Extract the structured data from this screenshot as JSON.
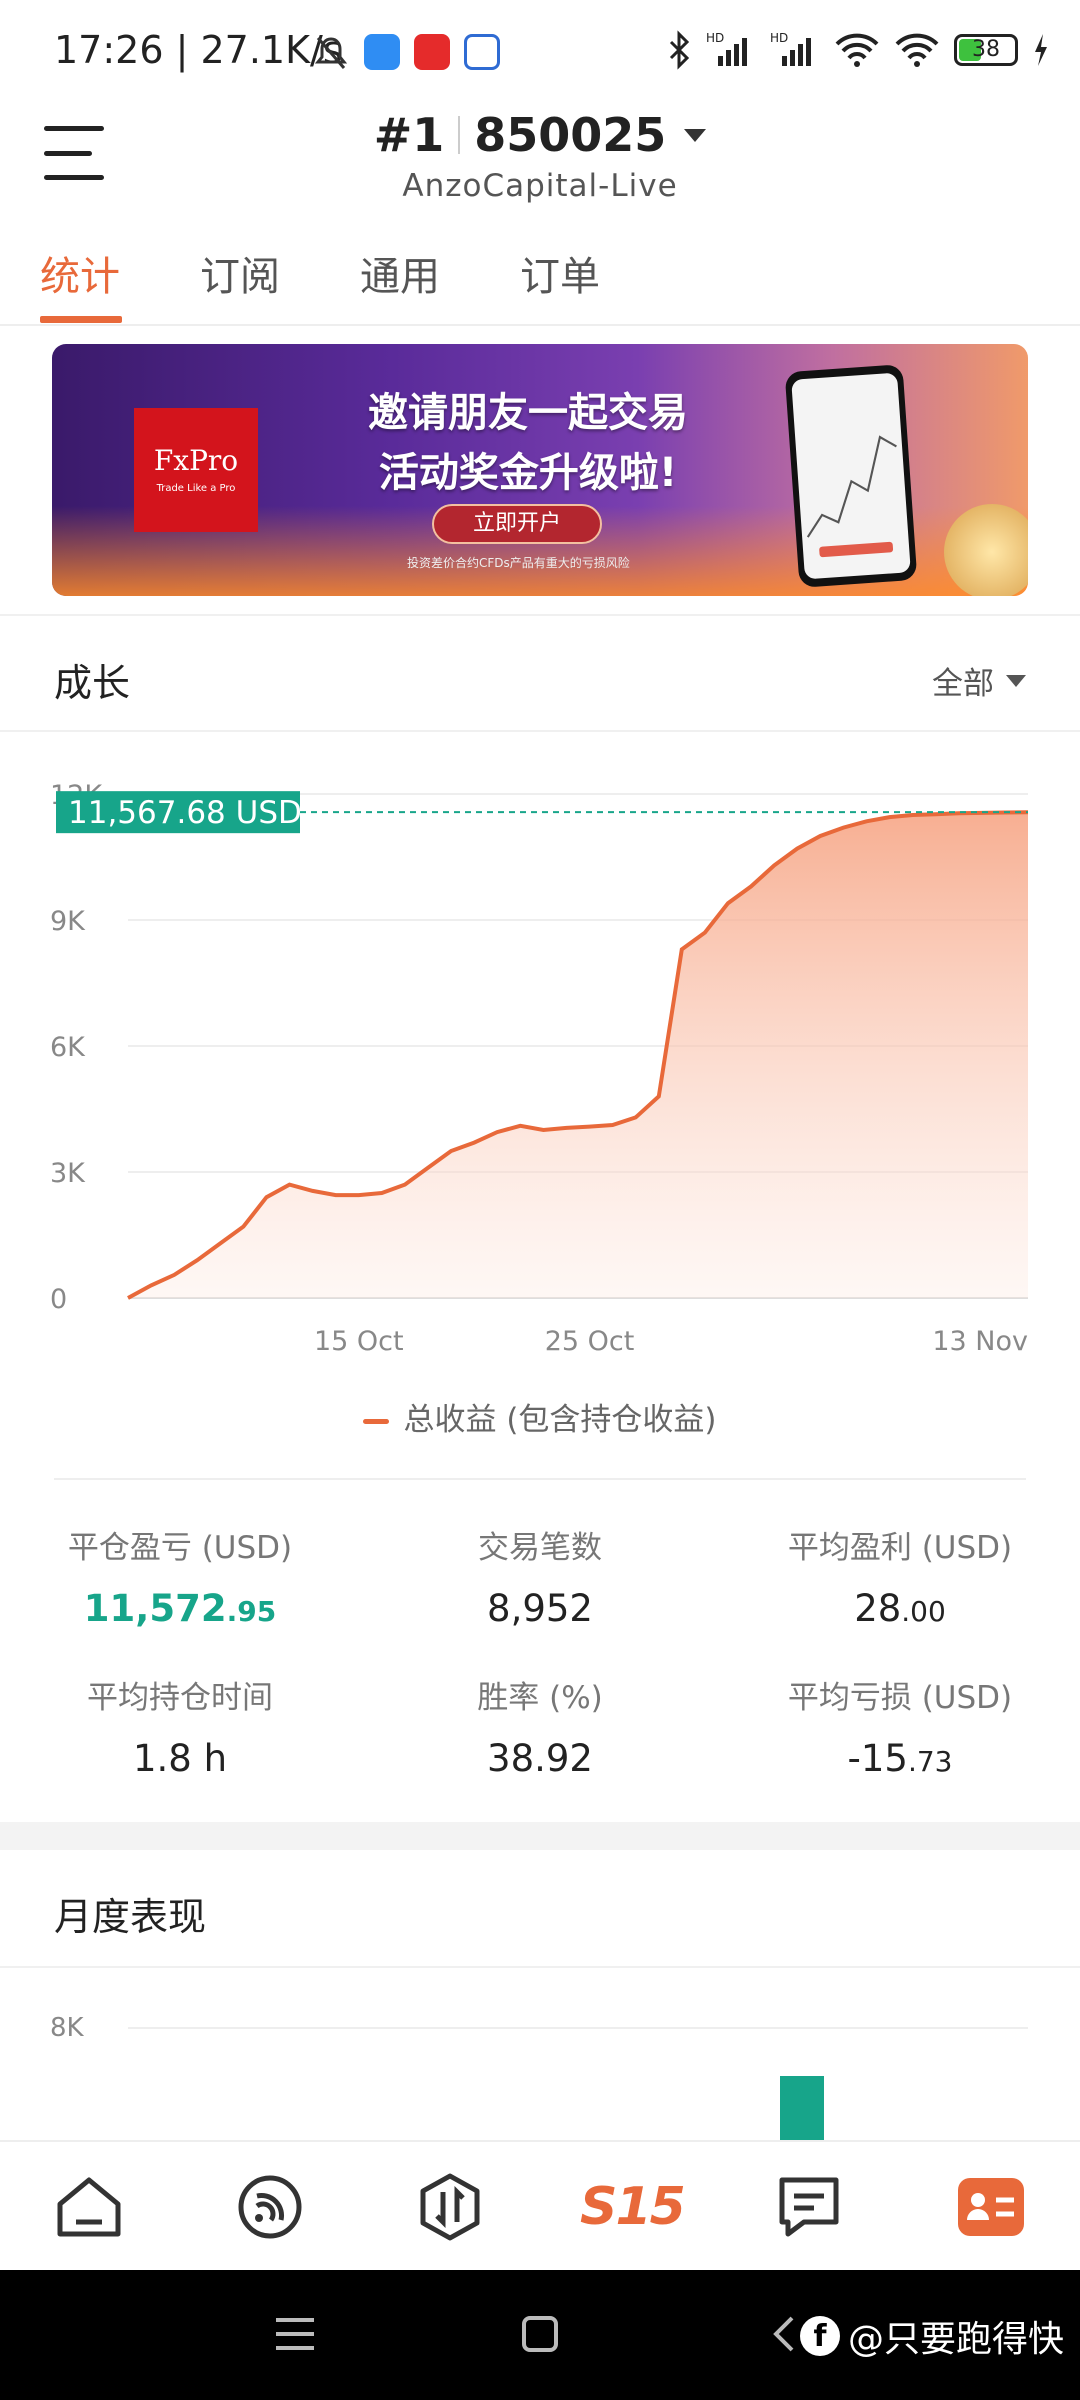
{
  "status_bar": {
    "time": "17:26",
    "speed": "27.1K/s",
    "battery": "38",
    "hd_label": "HD"
  },
  "header": {
    "account_index": "#1",
    "account_number": "850025",
    "server": "AnzoCapital-Live"
  },
  "tabs": [
    {
      "label": "统计",
      "active": true
    },
    {
      "label": "订阅",
      "active": false
    },
    {
      "label": "通用",
      "active": false
    },
    {
      "label": "订单",
      "active": false
    }
  ],
  "banner": {
    "brand": "FxPro",
    "brand_tagline": "Trade Like a Pro",
    "line1": "邀请朋友一起交易",
    "line2": "活动奖金升级啦!",
    "button": "立即开户",
    "disclaimer": "投资差价合约CFDs产品有重大的亏损风险"
  },
  "growth": {
    "title": "成长",
    "range": "全部",
    "current_value_label": "11,567.68 USD",
    "legend": "总收益 (包含持仓收益)"
  },
  "chart_data": {
    "type": "area",
    "x_ticks": [
      "15 Oct",
      "25 Oct",
      "13 Nov"
    ],
    "y_ticks": [
      "0",
      "3K",
      "6K",
      "9K",
      "12K"
    ],
    "ylim": [
      0,
      12000
    ],
    "series": [
      {
        "name": "总收益 (包含持仓收益)",
        "x": [
          "05 Oct",
          "06 Oct",
          "07 Oct",
          "08 Oct",
          "09 Oct",
          "10 Oct",
          "11 Oct",
          "12 Oct",
          "13 Oct",
          "14 Oct",
          "15 Oct",
          "16 Oct",
          "17 Oct",
          "18 Oct",
          "19 Oct",
          "20 Oct",
          "21 Oct",
          "22 Oct",
          "23 Oct",
          "24 Oct",
          "25 Oct",
          "26 Oct",
          "27 Oct",
          "28 Oct",
          "29 Oct",
          "30 Oct",
          "31 Oct",
          "01 Nov",
          "02 Nov",
          "03 Nov",
          "04 Nov",
          "05 Nov",
          "06 Nov",
          "07 Nov",
          "08 Nov",
          "09 Nov",
          "10 Nov",
          "11 Nov",
          "12 Nov",
          "13 Nov"
        ],
        "values": [
          0,
          300,
          550,
          900,
          1300,
          1700,
          2400,
          2700,
          2550,
          2450,
          2450,
          2500,
          2700,
          3100,
          3500,
          3700,
          3950,
          4100,
          4000,
          4050,
          4080,
          4120,
          4300,
          4800,
          8300,
          8700,
          9400,
          9800,
          10300,
          10700,
          11000,
          11200,
          11350,
          11450,
          11500,
          11520,
          11540,
          11550,
          11560,
          11567.68
        ]
      }
    ]
  },
  "stats": [
    {
      "label": "平仓盈亏 (USD)",
      "int": "11,572",
      "dec": ".95",
      "style": "green"
    },
    {
      "label": "交易笔数",
      "int": "8,952",
      "dec": "",
      "style": "normal"
    },
    {
      "label": "平均盈利 (USD)",
      "int": "28",
      "dec": ".00",
      "style": "normal"
    },
    {
      "label": "平均持仓时间",
      "int": "1.8 h",
      "dec": "",
      "style": "normal"
    },
    {
      "label": "胜率 (%)",
      "int": "38.92",
      "dec": "",
      "style": "normal"
    },
    {
      "label": "平均亏损 (USD)",
      "int": "-15",
      "dec": ".73",
      "style": "normal"
    }
  ],
  "monthly": {
    "title": "月度表现",
    "y_tick": "8K",
    "bar_color": "#17a58a"
  },
  "bottom_nav": [
    {
      "icon": "home-icon"
    },
    {
      "icon": "signal-icon"
    },
    {
      "icon": "trade-icon"
    },
    {
      "icon": "s15-logo",
      "label": "S15"
    },
    {
      "icon": "chat-icon"
    },
    {
      "icon": "profile-card-icon",
      "active": true
    }
  ],
  "system_nav": {
    "watermark": "@只要跑得快"
  },
  "colors": {
    "accent": "#e8693a",
    "positive": "#17a58a",
    "banner_red": "#d3141c"
  }
}
